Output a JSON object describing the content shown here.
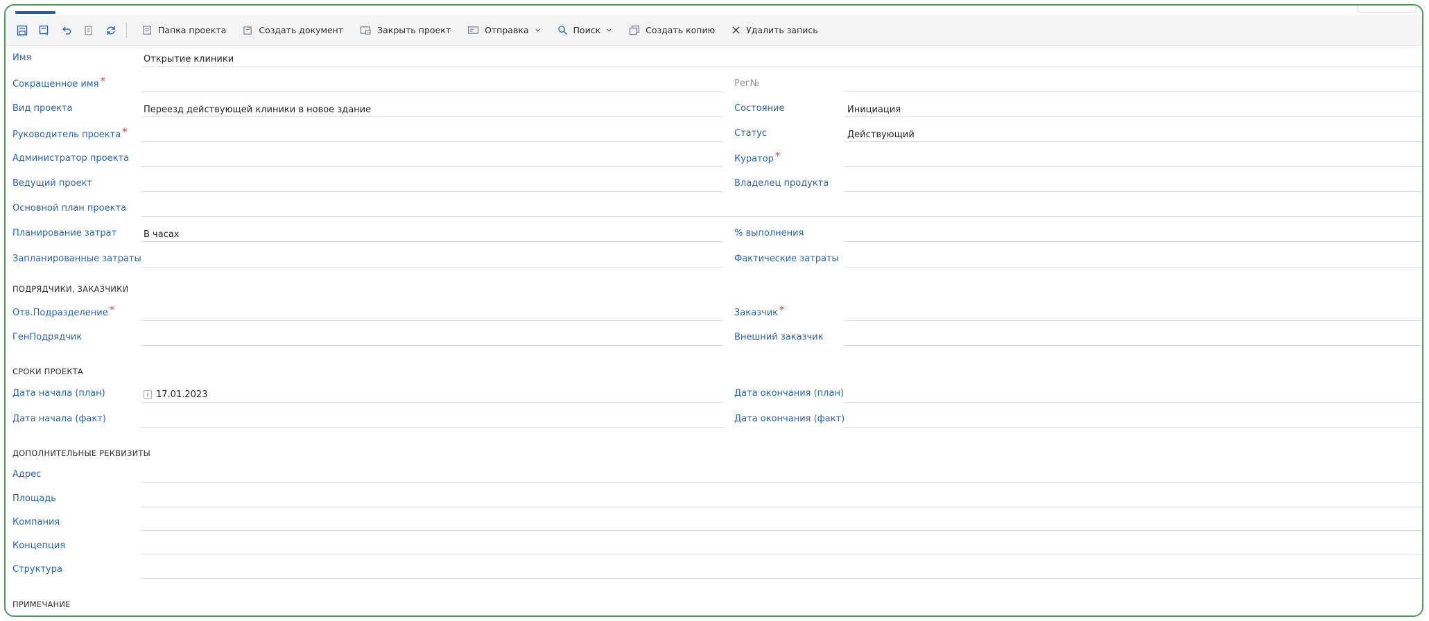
{
  "toolbar": {
    "items": [
      {
        "label": "Папка проекта",
        "icon": "folder-doc-icon"
      },
      {
        "label": "Создать документ",
        "icon": "new-doc-icon"
      },
      {
        "label": "Закрыть проект",
        "icon": "close-project-icon"
      },
      {
        "label": "Отправка",
        "icon": "send-icon",
        "dropdown": true
      },
      {
        "label": "Поиск",
        "icon": "search-icon",
        "dropdown": true
      },
      {
        "label": "Создать копию",
        "icon": "copy-icon"
      },
      {
        "label": "Удалить запись",
        "icon": "close-icon"
      }
    ]
  },
  "form": {
    "name": {
      "label": "Имя",
      "value": "Открытие клиники"
    },
    "short_name": {
      "label": "Сокращенное имя"
    },
    "reg_no": {
      "label": "Рег№"
    },
    "project_type": {
      "label": "Вид проекта",
      "value": "Переезд действующей клиники в новое здание"
    },
    "state": {
      "label": "Состояние",
      "value": "Инициация"
    },
    "manager": {
      "label": "Руководитель проекта"
    },
    "status": {
      "label": "Статус",
      "value": "Действующий"
    },
    "admin": {
      "label": "Администратор проекта"
    },
    "curator": {
      "label": "Куратор"
    },
    "lead_project": {
      "label": "Ведущий проект"
    },
    "product_owner": {
      "label": "Владелец продукта"
    },
    "base_plan": {
      "label": "Основной план проекта"
    },
    "cost_planning": {
      "label": "Планирование затрат",
      "value": "В часах"
    },
    "completion": {
      "label": "% выполнения"
    },
    "planned_costs": {
      "label": "Запланированные затраты"
    },
    "actual_costs": {
      "label": "Фактические затраты"
    },
    "contractors_section": "ПОДРЯДЧИКИ, ЗАКАЗЧИКИ",
    "resp_dept": {
      "label": "Отв.Подразделение"
    },
    "customer": {
      "label": "Заказчик"
    },
    "gen_contractor": {
      "label": "ГенПодрядчик"
    },
    "ext_customer": {
      "label": "Внешний заказчик"
    },
    "dates_section": "СРОКИ ПРОЕКТА",
    "start_plan": {
      "label": "Дата начала (план)",
      "value": "17.01.2023"
    },
    "end_plan": {
      "label": "Дата окончания (план)"
    },
    "start_fact": {
      "label": "Дата начала (факт)"
    },
    "end_fact": {
      "label": "Дата окончания (факт)"
    },
    "extra_section": "ДОПОЛНИТЕЛЬНЫЕ РЕКВИЗИТЫ",
    "address": {
      "label": "Адрес"
    },
    "area": {
      "label": "Площадь"
    },
    "company": {
      "label": "Компания"
    },
    "concept": {
      "label": "Концепция"
    },
    "structure": {
      "label": "Структура"
    },
    "note_section": "ПРИМЕЧАНИЕ"
  },
  "colors": {
    "accent": "#2a63b8",
    "required": "#e04040",
    "frame": "#4f9a5c"
  }
}
